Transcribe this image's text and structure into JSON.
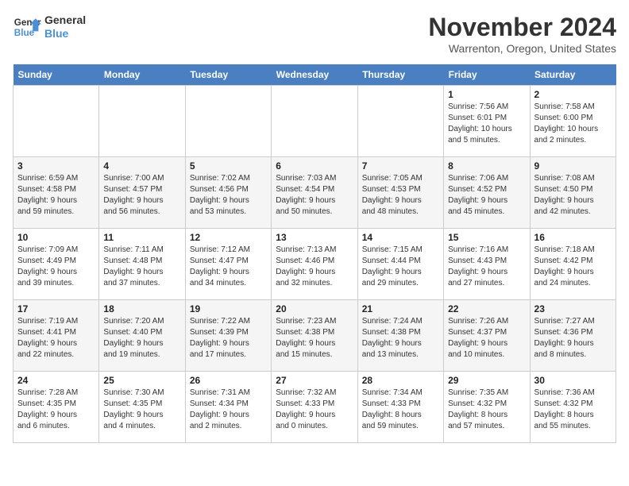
{
  "logo": {
    "line1": "General",
    "line2": "Blue"
  },
  "title": "November 2024",
  "location": "Warrenton, Oregon, United States",
  "weekdays": [
    "Sunday",
    "Monday",
    "Tuesday",
    "Wednesday",
    "Thursday",
    "Friday",
    "Saturday"
  ],
  "weeks": [
    [
      {
        "day": "",
        "info": ""
      },
      {
        "day": "",
        "info": ""
      },
      {
        "day": "",
        "info": ""
      },
      {
        "day": "",
        "info": ""
      },
      {
        "day": "",
        "info": ""
      },
      {
        "day": "1",
        "info": "Sunrise: 7:56 AM\nSunset: 6:01 PM\nDaylight: 10 hours\nand 5 minutes."
      },
      {
        "day": "2",
        "info": "Sunrise: 7:58 AM\nSunset: 6:00 PM\nDaylight: 10 hours\nand 2 minutes."
      }
    ],
    [
      {
        "day": "3",
        "info": "Sunrise: 6:59 AM\nSunset: 4:58 PM\nDaylight: 9 hours\nand 59 minutes."
      },
      {
        "day": "4",
        "info": "Sunrise: 7:00 AM\nSunset: 4:57 PM\nDaylight: 9 hours\nand 56 minutes."
      },
      {
        "day": "5",
        "info": "Sunrise: 7:02 AM\nSunset: 4:56 PM\nDaylight: 9 hours\nand 53 minutes."
      },
      {
        "day": "6",
        "info": "Sunrise: 7:03 AM\nSunset: 4:54 PM\nDaylight: 9 hours\nand 50 minutes."
      },
      {
        "day": "7",
        "info": "Sunrise: 7:05 AM\nSunset: 4:53 PM\nDaylight: 9 hours\nand 48 minutes."
      },
      {
        "day": "8",
        "info": "Sunrise: 7:06 AM\nSunset: 4:52 PM\nDaylight: 9 hours\nand 45 minutes."
      },
      {
        "day": "9",
        "info": "Sunrise: 7:08 AM\nSunset: 4:50 PM\nDaylight: 9 hours\nand 42 minutes."
      }
    ],
    [
      {
        "day": "10",
        "info": "Sunrise: 7:09 AM\nSunset: 4:49 PM\nDaylight: 9 hours\nand 39 minutes."
      },
      {
        "day": "11",
        "info": "Sunrise: 7:11 AM\nSunset: 4:48 PM\nDaylight: 9 hours\nand 37 minutes."
      },
      {
        "day": "12",
        "info": "Sunrise: 7:12 AM\nSunset: 4:47 PM\nDaylight: 9 hours\nand 34 minutes."
      },
      {
        "day": "13",
        "info": "Sunrise: 7:13 AM\nSunset: 4:46 PM\nDaylight: 9 hours\nand 32 minutes."
      },
      {
        "day": "14",
        "info": "Sunrise: 7:15 AM\nSunset: 4:44 PM\nDaylight: 9 hours\nand 29 minutes."
      },
      {
        "day": "15",
        "info": "Sunrise: 7:16 AM\nSunset: 4:43 PM\nDaylight: 9 hours\nand 27 minutes."
      },
      {
        "day": "16",
        "info": "Sunrise: 7:18 AM\nSunset: 4:42 PM\nDaylight: 9 hours\nand 24 minutes."
      }
    ],
    [
      {
        "day": "17",
        "info": "Sunrise: 7:19 AM\nSunset: 4:41 PM\nDaylight: 9 hours\nand 22 minutes."
      },
      {
        "day": "18",
        "info": "Sunrise: 7:20 AM\nSunset: 4:40 PM\nDaylight: 9 hours\nand 19 minutes."
      },
      {
        "day": "19",
        "info": "Sunrise: 7:22 AM\nSunset: 4:39 PM\nDaylight: 9 hours\nand 17 minutes."
      },
      {
        "day": "20",
        "info": "Sunrise: 7:23 AM\nSunset: 4:38 PM\nDaylight: 9 hours\nand 15 minutes."
      },
      {
        "day": "21",
        "info": "Sunrise: 7:24 AM\nSunset: 4:38 PM\nDaylight: 9 hours\nand 13 minutes."
      },
      {
        "day": "22",
        "info": "Sunrise: 7:26 AM\nSunset: 4:37 PM\nDaylight: 9 hours\nand 10 minutes."
      },
      {
        "day": "23",
        "info": "Sunrise: 7:27 AM\nSunset: 4:36 PM\nDaylight: 9 hours\nand 8 minutes."
      }
    ],
    [
      {
        "day": "24",
        "info": "Sunrise: 7:28 AM\nSunset: 4:35 PM\nDaylight: 9 hours\nand 6 minutes."
      },
      {
        "day": "25",
        "info": "Sunrise: 7:30 AM\nSunset: 4:35 PM\nDaylight: 9 hours\nand 4 minutes."
      },
      {
        "day": "26",
        "info": "Sunrise: 7:31 AM\nSunset: 4:34 PM\nDaylight: 9 hours\nand 2 minutes."
      },
      {
        "day": "27",
        "info": "Sunrise: 7:32 AM\nSunset: 4:33 PM\nDaylight: 9 hours\nand 0 minutes."
      },
      {
        "day": "28",
        "info": "Sunrise: 7:34 AM\nSunset: 4:33 PM\nDaylight: 8 hours\nand 59 minutes."
      },
      {
        "day": "29",
        "info": "Sunrise: 7:35 AM\nSunset: 4:32 PM\nDaylight: 8 hours\nand 57 minutes."
      },
      {
        "day": "30",
        "info": "Sunrise: 7:36 AM\nSunset: 4:32 PM\nDaylight: 8 hours\nand 55 minutes."
      }
    ]
  ]
}
